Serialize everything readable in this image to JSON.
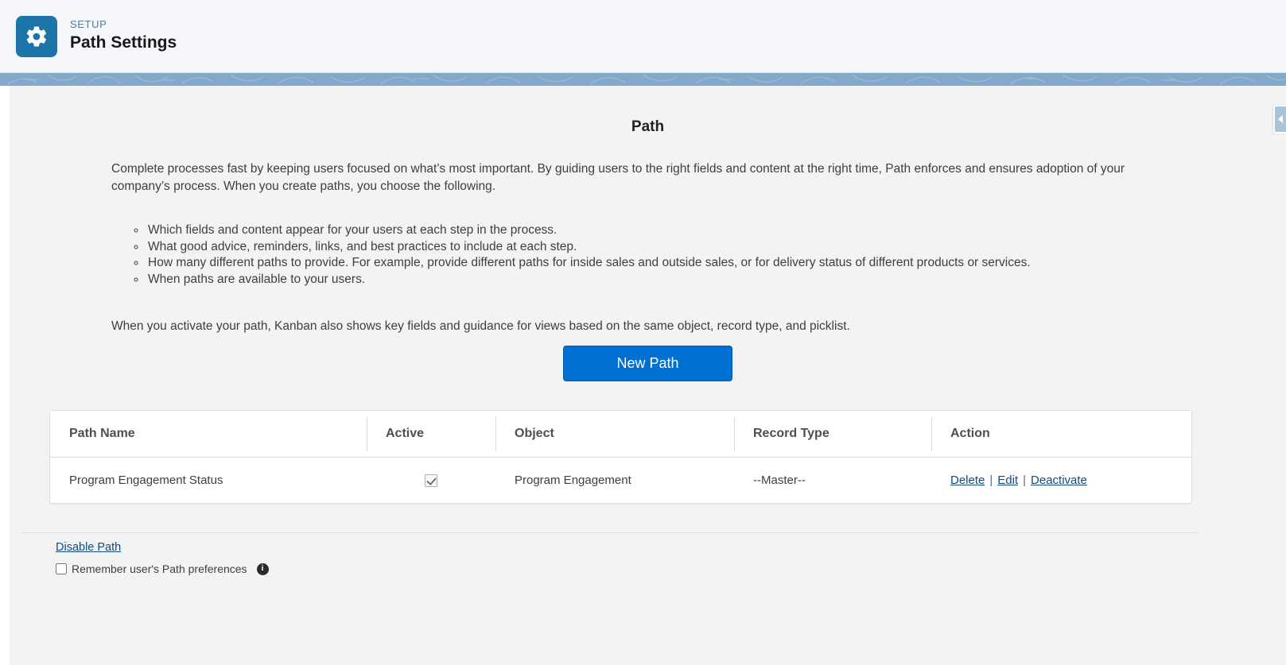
{
  "header": {
    "eyebrow": "SETUP",
    "title": "Path Settings",
    "icon": "gear-icon",
    "icon_bg": "#1b75a8"
  },
  "main": {
    "heading": "Path",
    "intro": "Complete processes fast by keeping users focused on what’s most important. By guiding users to the right fields and content at the right time, Path enforces and ensures adoption of your company’s process. When you create paths, you choose the following.",
    "bullets": [
      "Which fields and content appear for your users at each step in the process.",
      "What good advice, reminders, links, and best practices to include at each step.",
      "How many different paths to provide. For example, provide different paths for inside sales and outside sales, or for delivery status of different products or services.",
      "When paths are available to your users."
    ],
    "closing": "When you activate your path, Kanban also shows key fields and guidance for views based on the same object, record type, and picklist.",
    "new_path_button": "New Path",
    "new_path_button_color": "#0070d2"
  },
  "table": {
    "columns": [
      "Path Name",
      "Active",
      "Object",
      "Record Type",
      "Action"
    ],
    "rows": [
      {
        "path_name": "Program Engagement Status",
        "active": true,
        "object": "Program Engagement",
        "record_type": "--Master--",
        "actions": [
          "Delete",
          "Edit",
          "Deactivate"
        ],
        "separator": "|"
      }
    ]
  },
  "footer": {
    "disable_path_link": "Disable Path",
    "remember_label": "Remember user's Path preferences",
    "remember_checked": false,
    "info_icon": "info-icon",
    "info_glyph": "i"
  },
  "collapse_handle": {
    "name": "collapse-panel-handle",
    "direction": "left"
  }
}
